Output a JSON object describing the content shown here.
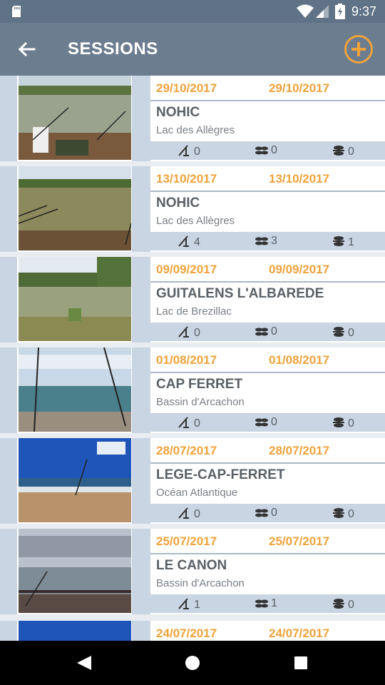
{
  "status_bar": {
    "time": "9:37"
  },
  "app_bar": {
    "title": "SESSIONS"
  },
  "sessions": [
    {
      "start": "29/10/2017",
      "end": "29/10/2017",
      "name": "NOHIC",
      "location": "Lac des Allègres",
      "stat1": "0",
      "stat2": "0",
      "stat3": "0"
    },
    {
      "start": "13/10/2017",
      "end": "13/10/2017",
      "name": "NOHIC",
      "location": "Lac des Allègres",
      "stat1": "4",
      "stat2": "3",
      "stat3": "1"
    },
    {
      "start": "09/09/2017",
      "end": "09/09/2017",
      "name": "GUITALENS L'ALBAREDE",
      "location": "Lac de Brezillac",
      "stat1": "0",
      "stat2": "0",
      "stat3": "0"
    },
    {
      "start": "01/08/2017",
      "end": "01/08/2017",
      "name": "CAP FERRET",
      "location": "Bassin d'Arcachon",
      "stat1": "0",
      "stat2": "0",
      "stat3": "0"
    },
    {
      "start": "28/07/2017",
      "end": "28/07/2017",
      "name": "LEGE-CAP-FERRET",
      "location": "Océan Atlantique",
      "stat1": "0",
      "stat2": "0",
      "stat3": "0"
    },
    {
      "start": "25/07/2017",
      "end": "25/07/2017",
      "name": "LE CANON",
      "location": "Bassin d'Arcachon",
      "stat1": "1",
      "stat2": "1",
      "stat3": "0"
    },
    {
      "start": "24/07/2017",
      "end": "24/07/2017"
    }
  ],
  "colors": {
    "accent": "#f0a23a",
    "app_bar": "#6c7d90",
    "status_bar": "#5f7286",
    "stripe": "#c9d5e3"
  }
}
